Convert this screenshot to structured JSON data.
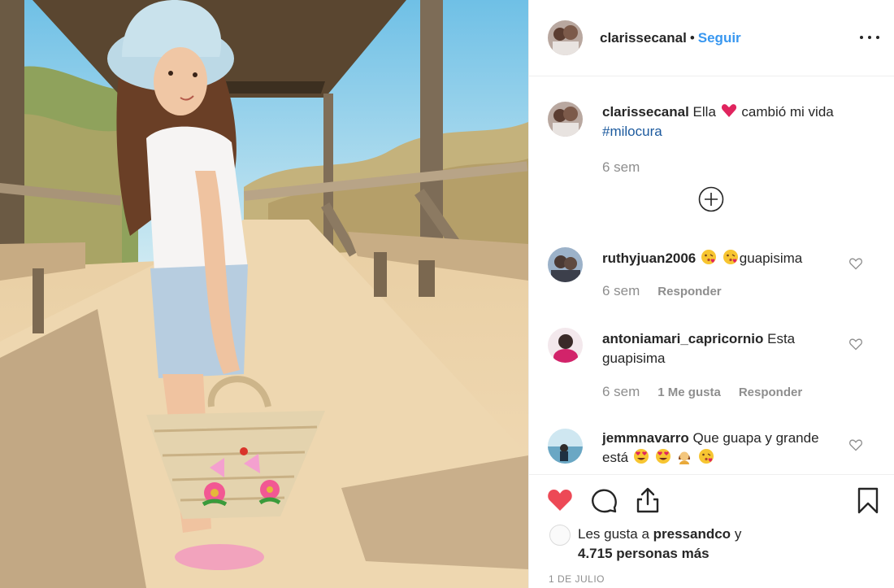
{
  "post": {
    "author": "clarissecanal",
    "separator": "•",
    "follow_label": "Seguir",
    "more_icon": "more-options-icon"
  },
  "caption": {
    "username": "clarissecanal",
    "text_before": "Ella",
    "text_after": "cambió mi vida",
    "hashtag": "#milocura",
    "time": "6 sem"
  },
  "comments": [
    {
      "username": "ruthyjuan2006",
      "text": "guapisima",
      "time": "6 sem",
      "likes": "",
      "reply_label": "Responder"
    },
    {
      "username": "antoniamari_capricornio",
      "text": "Esta guapisima",
      "time": "6 sem",
      "likes": "1 Me gusta",
      "reply_label": "Responder"
    },
    {
      "username": "jemmnavarro",
      "text": "Que guapa y grande está",
      "time": "",
      "likes": "",
      "reply_label": ""
    }
  ],
  "actions": {
    "like_icon": "heart-filled-icon",
    "comment_icon": "comment-icon",
    "share_icon": "share-icon",
    "save_icon": "bookmark-icon"
  },
  "likes": {
    "prefix": "Les gusta a",
    "user": "pressandco",
    "joiner": "y",
    "others": "4.715 personas más"
  },
  "date": "1 DE JULIO",
  "colors": {
    "link_blue": "#3897f0",
    "hashtag_blue": "#1c5a9e",
    "like_red": "#ed4956",
    "muted": "#8e8e8e",
    "text": "#262626"
  }
}
